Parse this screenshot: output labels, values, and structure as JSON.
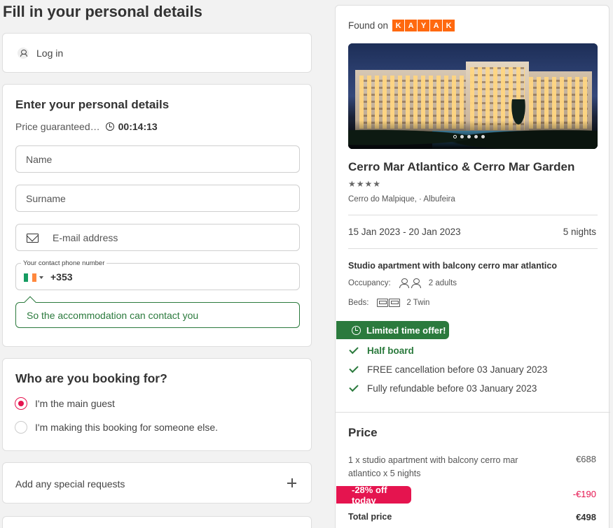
{
  "page": {
    "title": "Fill in your personal details"
  },
  "login": {
    "label": "Log in",
    "icon": "user-icon"
  },
  "details": {
    "heading": "Enter your personal details",
    "guarantee_text": "Price guaranteed…",
    "timer": "00:14:13",
    "name_placeholder": "Name",
    "surname_placeholder": "Surname",
    "email_placeholder": "E-mail address",
    "phone_label": "Your contact phone number",
    "phone_code": "+353",
    "phone_country_flag": "ireland-flag",
    "hint": "So the accommodation can contact you"
  },
  "booking_for": {
    "heading": "Who are you booking for?",
    "options": [
      {
        "label": "I'm the main guest",
        "selected": true
      },
      {
        "label": "I'm making this booking for someone else.",
        "selected": false
      }
    ]
  },
  "requests": {
    "label": "Add any special requests",
    "icon": "plus-icon"
  },
  "summary": {
    "found_on": "Found on",
    "brand_letters": [
      "K",
      "A",
      "Y",
      "A",
      "K"
    ],
    "image_slides": 5,
    "image_active_slide": 1,
    "hotel_name": "Cerro Mar Atlantico & Cerro Mar Garden",
    "stars": "★★★★",
    "star_rating": 4,
    "location": "Cerro do Malpique, · Albufeira",
    "dates": "15 Jan 2023 - 20 Jan 2023",
    "nights": "5 nights",
    "room_name": "Studio apartment with balcony cerro mar atlantico",
    "occupancy_label": "Occupancy:",
    "occupancy_value": "2 adults",
    "beds_label": "Beds:",
    "beds_value": "2 Twin",
    "offer_badge": "Limited time offer!",
    "perks": [
      "Half board",
      "FREE cancellation before 03 January 2023",
      "Fully refundable before 03 January 2023"
    ]
  },
  "price": {
    "heading": "Price",
    "line_item": "1 x studio apartment with balcony cerro mar atlantico x 5 nights",
    "line_amount": "€688",
    "discount_badge": "-28% off today",
    "discount_amount": "-€190",
    "total_label": "Total price",
    "total_amount": "€498"
  },
  "colors": {
    "accent_green": "#2b7a3d",
    "accent_pink": "#e5144f",
    "kayak_orange": "#ff690f",
    "ireland_flag": [
      "#169b62",
      "#ffffff",
      "#ff883e"
    ]
  }
}
